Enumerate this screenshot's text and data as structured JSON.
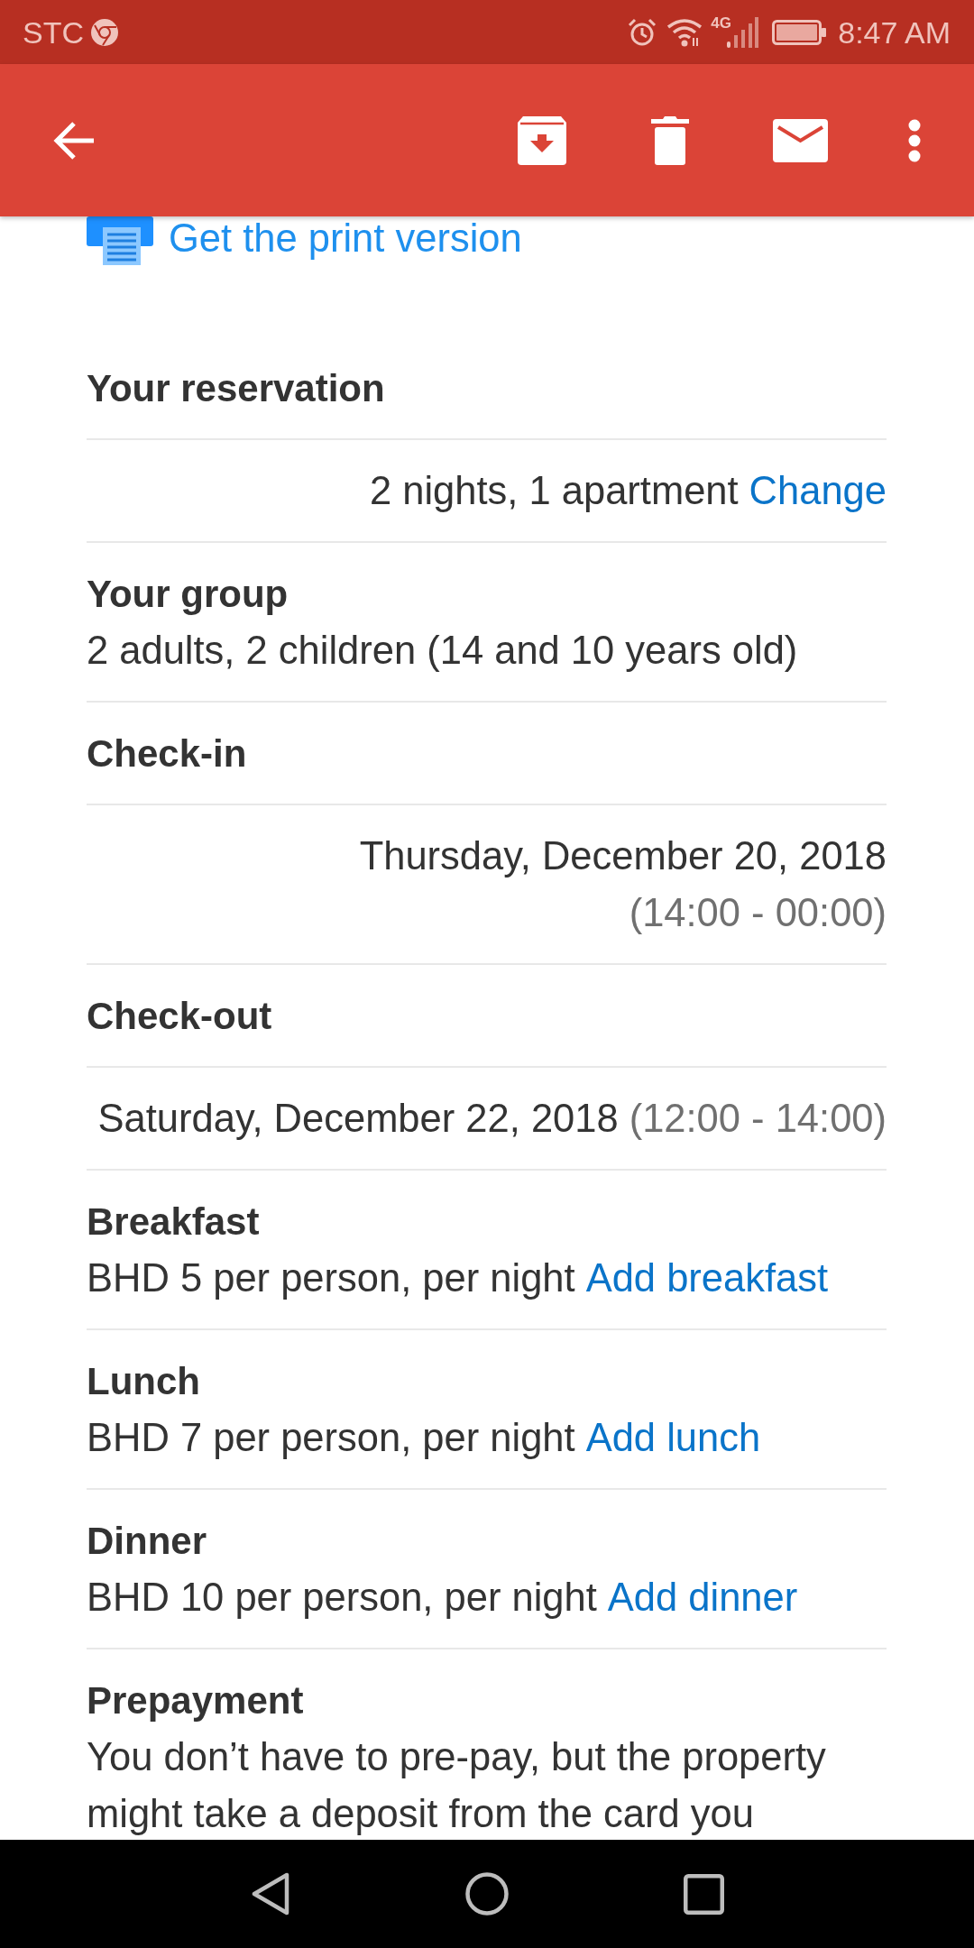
{
  "status_bar": {
    "carrier": "STC",
    "network": "4G",
    "time": "8:47 AM"
  },
  "print_link": "Get the print version",
  "rows": [
    {
      "kind": "left",
      "label": "Your reservation"
    },
    {
      "kind": "right",
      "lines": [
        [
          {
            "kind": "text",
            "text": "2 nights, 1 apartment"
          },
          {
            "kind": "link",
            "text": "Change"
          }
        ]
      ]
    },
    {
      "kind": "left",
      "label": "Your group",
      "lines": [
        [
          {
            "kind": "text",
            "text": "2 adults, 2 children (14 and 10 years old)"
          }
        ]
      ]
    },
    {
      "kind": "left",
      "label": "Check-in"
    },
    {
      "kind": "right",
      "lines": [
        [
          {
            "kind": "text",
            "text": "Thursday, December 20, 2018"
          }
        ],
        [
          {
            "kind": "hours",
            "text": "(14:00 - 00:00)"
          }
        ]
      ]
    },
    {
      "kind": "left",
      "label": "Check-out"
    },
    {
      "kind": "right",
      "lines": [
        [
          {
            "kind": "text",
            "text": "Saturday, December 22, 2018"
          },
          {
            "kind": "hours",
            "text": "(12:00 - 14:00)"
          }
        ]
      ]
    },
    {
      "kind": "left",
      "label": "Breakfast",
      "lines": [
        [
          {
            "kind": "text",
            "text": "BHD 5 per person, per night"
          },
          {
            "kind": "link",
            "text": "Add breakfast"
          }
        ]
      ]
    },
    {
      "kind": "left",
      "label": "Lunch",
      "lines": [
        [
          {
            "kind": "text",
            "text": "BHD 7 per person, per night"
          },
          {
            "kind": "link",
            "text": "Add lunch"
          }
        ]
      ]
    },
    {
      "kind": "left",
      "label": "Dinner",
      "lines": [
        [
          {
            "kind": "text",
            "text": "BHD 10 per person, per night"
          },
          {
            "kind": "link",
            "text": "Add dinner"
          }
        ]
      ]
    },
    {
      "kind": "left",
      "label": "Prepayment",
      "paragraph": [
        "You don’t have to pre-pay, but the property",
        "might take a deposit from the card you"
      ]
    }
  ]
}
